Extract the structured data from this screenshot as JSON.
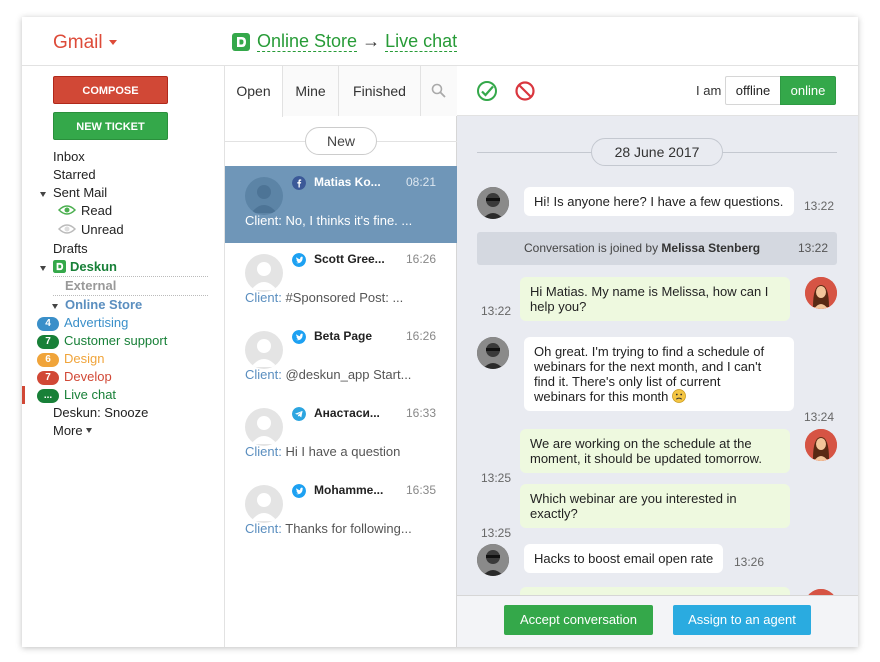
{
  "header": {
    "app_name": "Gmail",
    "breadcrumb_store": "Online Store",
    "breadcrumb_arrow": "→",
    "breadcrumb_section": "Live chat"
  },
  "sidebar": {
    "compose_label": "COMPOSE",
    "new_ticket_label": "NEW TICKET",
    "inbox": "Inbox",
    "starred": "Starred",
    "sent_mail": "Sent Mail",
    "read": "Read",
    "unread": "Unread",
    "drafts": "Drafts",
    "deskun": "Deskun",
    "external": "External",
    "online_store": "Online Store",
    "labels": [
      {
        "badge": "4",
        "name": "Advertising",
        "color": "#3a8fc9"
      },
      {
        "badge": "7",
        "name": "Customer support",
        "color": "#188038"
      },
      {
        "badge": "6",
        "name": "Design",
        "color": "#f0a43a"
      },
      {
        "badge": "7",
        "name": "Develop",
        "color": "#d14836"
      },
      {
        "badge": "...",
        "name": "Live chat",
        "color": "#188038"
      }
    ],
    "snooze": "Deskun: Snooze",
    "more": "More"
  },
  "conversations": {
    "tabs": [
      "Open",
      "Mine",
      "Finished"
    ],
    "new_label": "New",
    "client_label": "Client:",
    "items": [
      {
        "source": "facebook",
        "name": "Matias Ko...",
        "time": "08:21",
        "preview": "No, I thinks it's fine. ..."
      },
      {
        "source": "twitter",
        "name": "Scott Gree...",
        "time": "16:26",
        "preview": "#Sponsored Post: ..."
      },
      {
        "source": "twitter",
        "name": "Beta Page",
        "time": "16:26",
        "preview": "@deskun_app Start..."
      },
      {
        "source": "telegram",
        "name": "Анастаси...",
        "time": "16:33",
        "preview": "Hi I have a question"
      },
      {
        "source": "twitter",
        "name": "Mohamme...",
        "time": "16:35",
        "preview": "Thanks for following..."
      }
    ]
  },
  "chat": {
    "status_label": "I am",
    "offline_label": "offline",
    "online_label": "online",
    "date": "28 June 2017",
    "system_prefix": "Conversation is joined by",
    "system_agent": "Melissa Stenberg",
    "system_time": "13:22",
    "messages": [
      {
        "text": "Hi! Is anyone here? I have a few questions.",
        "time": "13:22"
      },
      {
        "text": "Hi Matias. My name is Melissa, how can I help you?",
        "time": "13:22"
      },
      {
        "text": "Oh great. I'm trying to find a schedule of webinars for the next month, and I can't find it. There's only list of current webinars for this month",
        "time": "13:24"
      },
      {
        "text": "We are working on the schedule at the moment, it should be updated tomorrow.",
        "time": "13:25"
      },
      {
        "text": "Which webinar are you interested in exactly?",
        "time": "13:25"
      },
      {
        "text": "Hacks to boost email open rate",
        "time": "13:26"
      }
    ],
    "accept_label": "Accept conversation",
    "assign_label": "Assign to an agent"
  },
  "colors": {
    "gmail_red": "#dd4b39",
    "deskun_green": "#279b37",
    "selected_row": "#6f96b8",
    "online_green": "#34a84a",
    "assign_blue": "#2aabe0"
  }
}
